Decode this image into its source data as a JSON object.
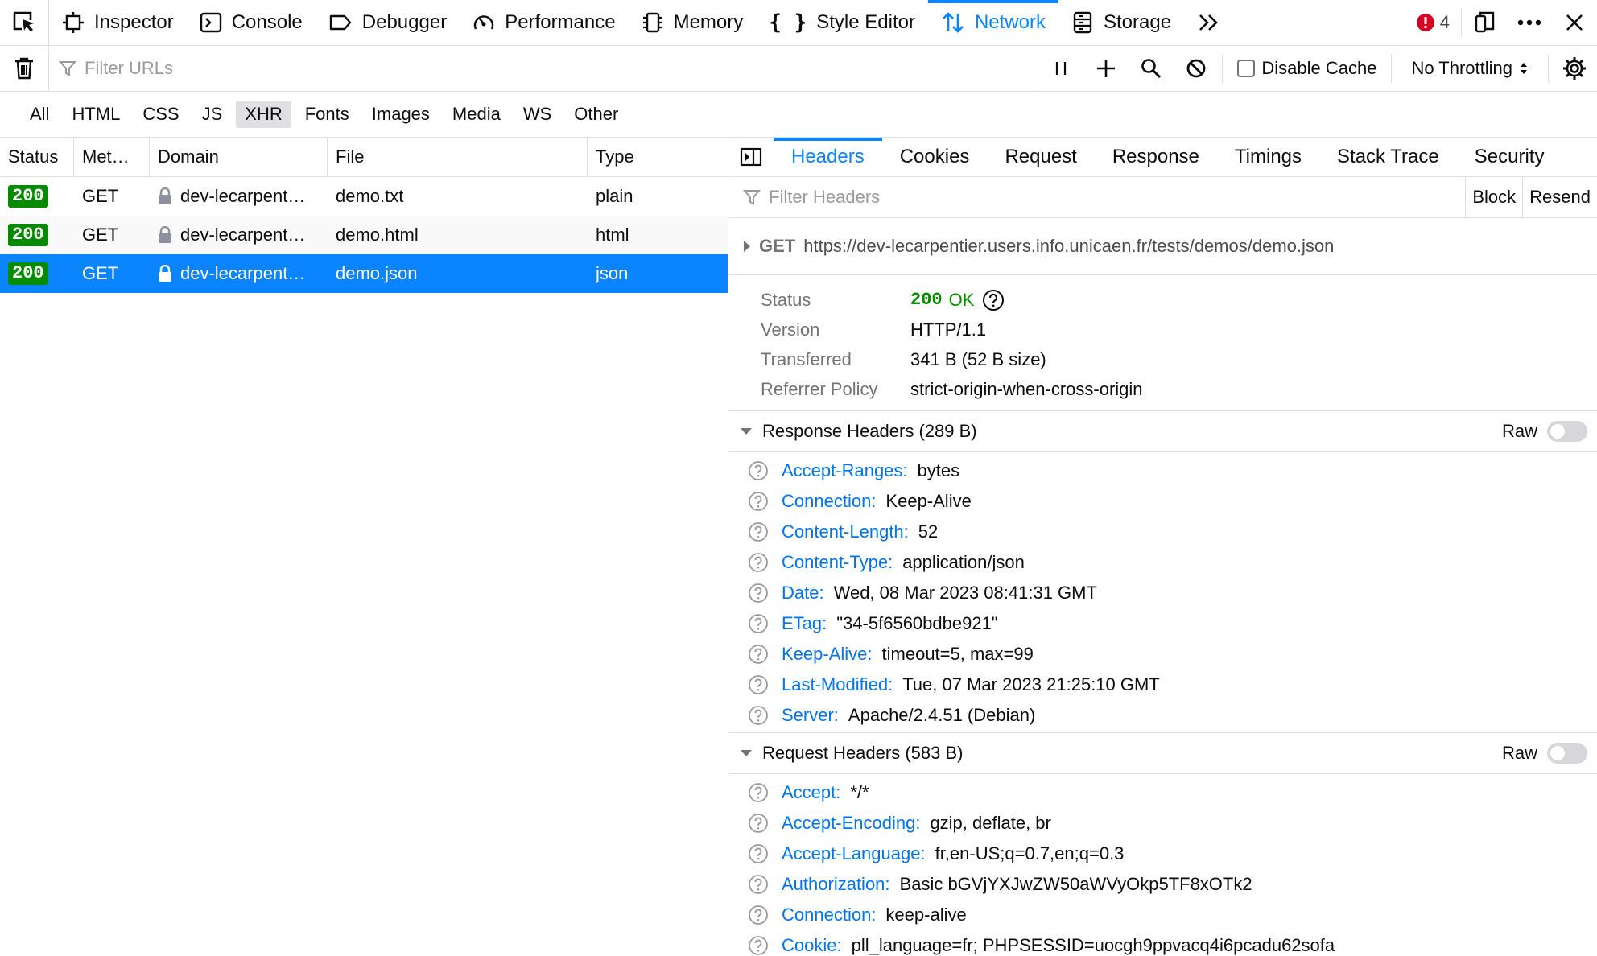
{
  "toolbar": {
    "tools": [
      {
        "label": "Inspector",
        "icon": "inspector-icon"
      },
      {
        "label": "Console",
        "icon": "console-icon"
      },
      {
        "label": "Debugger",
        "icon": "debugger-icon"
      },
      {
        "label": "Performance",
        "icon": "performance-icon"
      },
      {
        "label": "Memory",
        "icon": "memory-icon"
      },
      {
        "label": "Style Editor",
        "icon": "style-editor-icon"
      },
      {
        "label": "Network",
        "icon": "network-icon",
        "active": true
      },
      {
        "label": "Storage",
        "icon": "storage-icon"
      }
    ],
    "error_count": "4"
  },
  "filterbar": {
    "url_placeholder": "Filter URLs",
    "disable_cache_label": "Disable Cache",
    "throttling_label": "No Throttling"
  },
  "type_filters": [
    "All",
    "HTML",
    "CSS",
    "JS",
    "XHR",
    "Fonts",
    "Images",
    "Media",
    "WS",
    "Other"
  ],
  "type_filters_active": "XHR",
  "requests": {
    "columns": [
      "Status",
      "Met…",
      "Domain",
      "File",
      "Type"
    ],
    "rows": [
      {
        "status": "200",
        "method": "GET",
        "domain": "dev-lecarpent…",
        "file": "demo.txt",
        "type": "plain"
      },
      {
        "status": "200",
        "method": "GET",
        "domain": "dev-lecarpent…",
        "file": "demo.html",
        "type": "html"
      },
      {
        "status": "200",
        "method": "GET",
        "domain": "dev-lecarpent…",
        "file": "demo.json",
        "type": "json",
        "selected": true
      }
    ]
  },
  "details": {
    "tabs": [
      "Headers",
      "Cookies",
      "Request",
      "Response",
      "Timings",
      "Stack Trace",
      "Security"
    ],
    "active_tab": "Headers",
    "filter_placeholder": "Filter Headers",
    "block_label": "Block",
    "resend_label": "Resend",
    "method": "GET",
    "url": "https://dev-lecarpentier.users.info.unicaen.fr/tests/demos/demo.json",
    "summary": {
      "status_label": "Status",
      "status_code": "200",
      "status_text": "OK",
      "version_label": "Version",
      "version": "HTTP/1.1",
      "transferred_label": "Transferred",
      "transferred": "341 B (52 B size)",
      "referrer_label": "Referrer Policy",
      "referrer": "strict-origin-when-cross-origin"
    },
    "raw_label": "Raw",
    "response_headers": {
      "title": "Response Headers (289 B)",
      "items": [
        {
          "name": "Accept-Ranges:",
          "value": "bytes"
        },
        {
          "name": "Connection:",
          "value": "Keep-Alive"
        },
        {
          "name": "Content-Length:",
          "value": "52"
        },
        {
          "name": "Content-Type:",
          "value": "application/json"
        },
        {
          "name": "Date:",
          "value": "Wed, 08 Mar 2023 08:41:31 GMT"
        },
        {
          "name": "ETag:",
          "value": "\"34-5f6560bdbe921\""
        },
        {
          "name": "Keep-Alive:",
          "value": "timeout=5, max=99"
        },
        {
          "name": "Last-Modified:",
          "value": "Tue, 07 Mar 2023 21:25:10 GMT"
        },
        {
          "name": "Server:",
          "value": "Apache/2.4.51 (Debian)"
        }
      ]
    },
    "request_headers": {
      "title": "Request Headers (583 B)",
      "items": [
        {
          "name": "Accept:",
          "value": "*/*"
        },
        {
          "name": "Accept-Encoding:",
          "value": "gzip, deflate, br"
        },
        {
          "name": "Accept-Language:",
          "value": "fr,en-US;q=0.7,en;q=0.3"
        },
        {
          "name": "Authorization:",
          "value": "Basic bGVjYXJwZW50aWVyOkp5TF8xOTk2"
        },
        {
          "name": "Connection:",
          "value": "keep-alive"
        },
        {
          "name": "Cookie:",
          "value": "pll_language=fr; PHPSESSID=uocgh9ppvacq4i6pcadu62sofa"
        }
      ]
    }
  },
  "colors": {
    "accent": "#0a84ff",
    "status_ok": "#058b00",
    "header_name": "#0074e8"
  }
}
